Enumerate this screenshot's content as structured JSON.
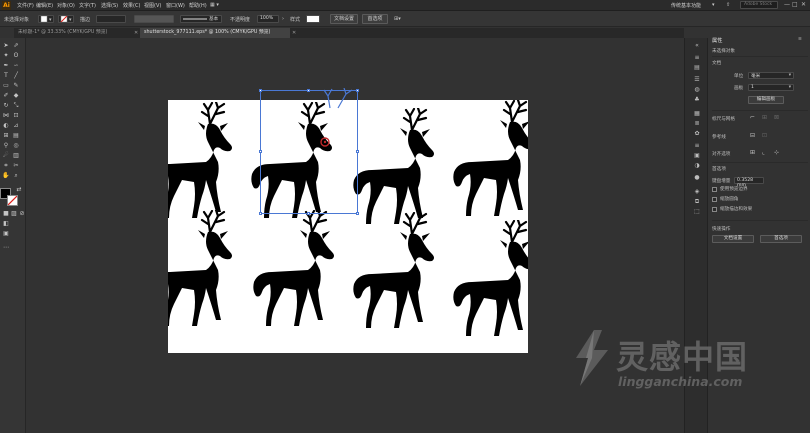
{
  "menubar": {
    "app_logo": "Ai",
    "menus": [
      "文件(F)",
      "编辑(E)",
      "对象(O)",
      "文字(T)",
      "选择(S)",
      "效果(C)",
      "视图(V)",
      "窗口(W)",
      "帮助(H)"
    ],
    "workspace": "传统基本功能",
    "search_placeholder": "Adobe Stock",
    "window_controls": [
      "—",
      "□",
      "✕"
    ]
  },
  "controlbar": {
    "selection_label": "未选择对象",
    "stroke_label": "描边",
    "stroke_style": "基本",
    "opacity_label": "不透明度",
    "opacity_value": "100%",
    "style_label": "样式",
    "doc_setup_button": "文档设置",
    "preferences_button": "首选项"
  },
  "tabs": [
    {
      "label": "未标题-1* @ 33.33% (CMYK/GPU 预览)",
      "close": "✕"
    },
    {
      "label": "shutterstock_977111.eps* @ 100% (CMYK/GPU 预览)",
      "close": "✕"
    }
  ],
  "properties": {
    "title": "属性",
    "selection_state": "未选择对象",
    "document_section": "文档",
    "units_label": "单位",
    "units_value": "毫米",
    "artboard_label": "画板",
    "artboard_value": "1",
    "edit_artboards_button": "编辑画板",
    "ruler_grid_label": "标尺与网格",
    "guides_label": "参考线",
    "snap_label": "对齐选项",
    "preferences_section": "首选项",
    "keyboard_increment_label": "键盘增量",
    "keyboard_increment_value": "0.3528 mm",
    "checkboxes": [
      "使用预览边界",
      "缩放圆角",
      "缩放描边和效果"
    ],
    "quick_actions_label": "快速操作",
    "doc_setup_button": "文档设置",
    "preferences_button": "首选项"
  },
  "watermark": {
    "name": "灵感中国",
    "url": "lingganchina.com"
  },
  "colors": {
    "accent": "#ff9a00",
    "selection": "#4a78d4",
    "artboard": "#ffffff",
    "deer": "#000000"
  }
}
